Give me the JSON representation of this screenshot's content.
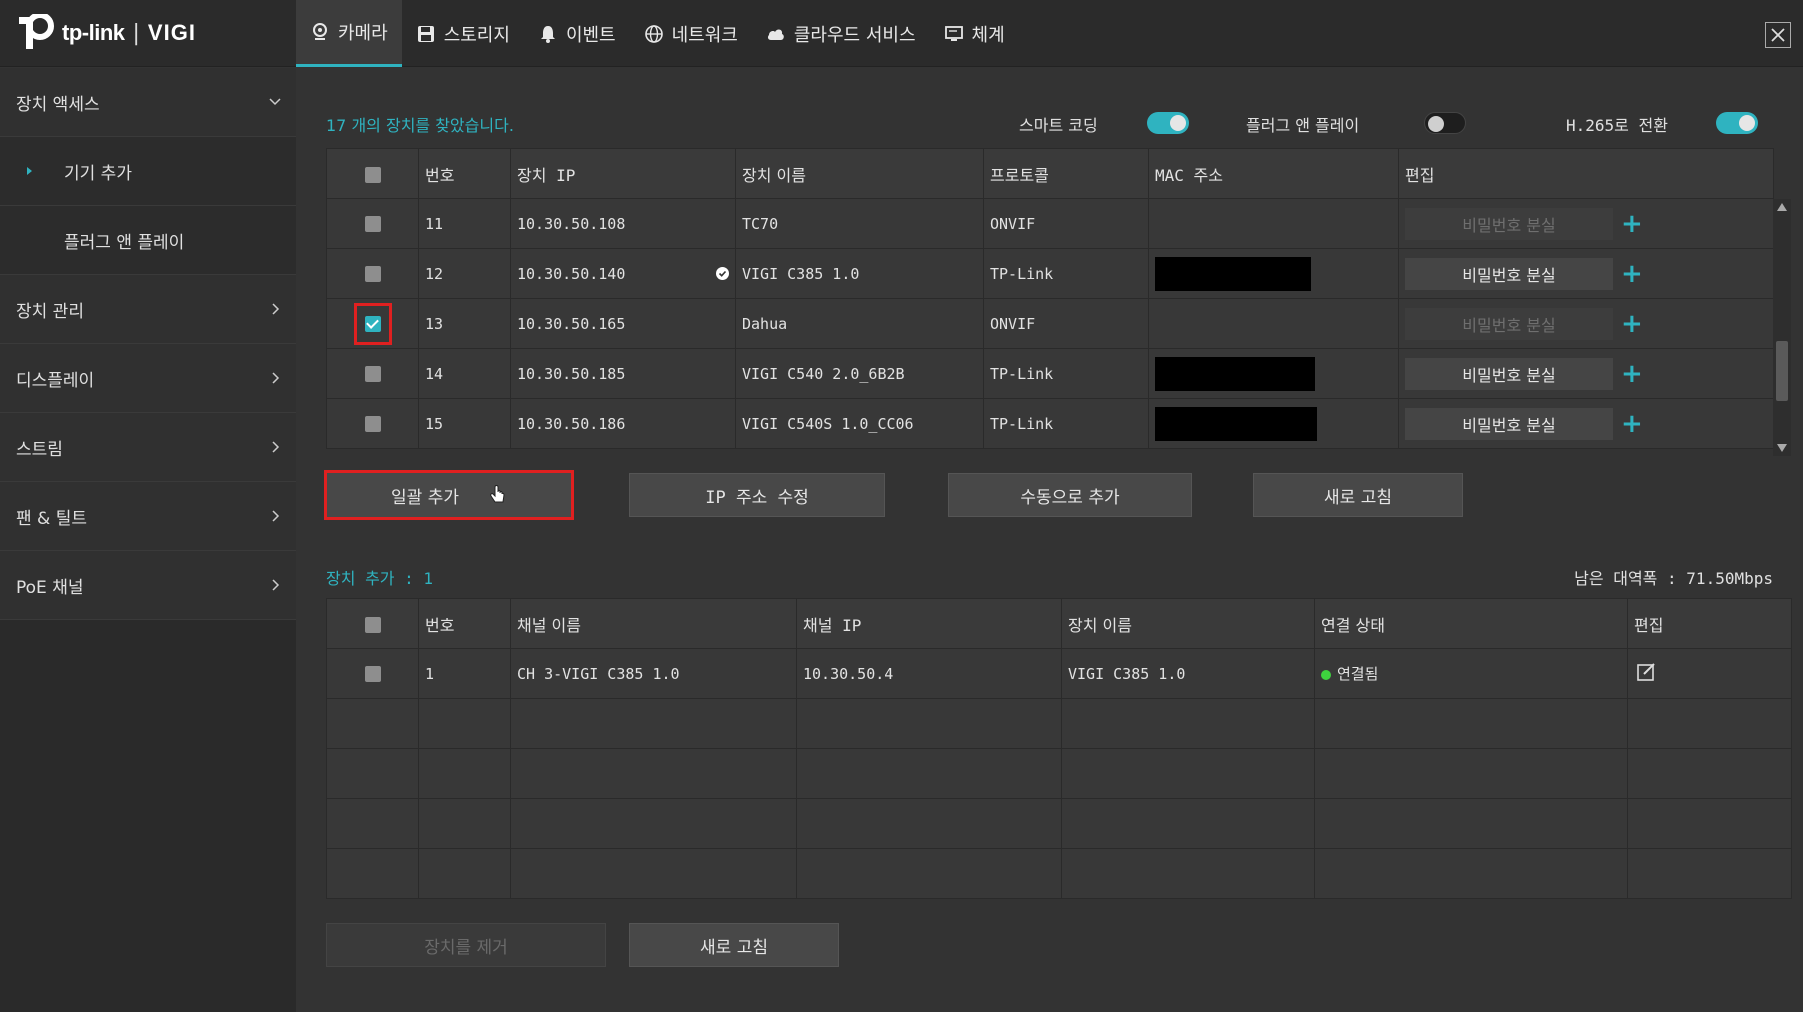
{
  "brand": {
    "logo_text": "tp-link",
    "logo_separator": "|",
    "product": "VIGI"
  },
  "tabs": [
    {
      "label": "카메라",
      "icon": "camera-icon",
      "active": true
    },
    {
      "label": "스토리지",
      "icon": "save-icon"
    },
    {
      "label": "이벤트",
      "icon": "bell-icon"
    },
    {
      "label": "네트워크",
      "icon": "globe-icon"
    },
    {
      "label": "클라우드 서비스",
      "icon": "cloud-icon"
    },
    {
      "label": "체계",
      "icon": "monitor-icon"
    }
  ],
  "sidebar": {
    "items": [
      {
        "label": "장치 액세스",
        "chevron": "down"
      },
      {
        "label": "기기 추가",
        "sub": true,
        "active": true
      },
      {
        "label": "플러그 앤 플레이",
        "sub": true
      },
      {
        "label": "장치 관리",
        "chevron": "right"
      },
      {
        "label": "디스플레이",
        "chevron": "right"
      },
      {
        "label": "스트림",
        "chevron": "right"
      },
      {
        "label": "팬 & 틸트",
        "chevron": "right"
      },
      {
        "label": "PoE 채널",
        "chevron": "right"
      }
    ]
  },
  "discovery": {
    "found_text": "17 개의 장치를 찾았습니다.",
    "smart_coding_label": "스마트 코딩",
    "smart_coding_on": true,
    "plug_play_label": "플러그 앤 플레이",
    "plug_play_on": false,
    "h265_label": "H.265로 전환",
    "h265_on": true,
    "headers": [
      "번호",
      "장치 IP",
      "장치 이름",
      "프로토콜",
      "MAC 주소",
      "편집"
    ],
    "rows": [
      {
        "no": "11",
        "ip": "10.30.50.108",
        "name": "TC70",
        "protocol": "ONVIF",
        "mac_redacted": false,
        "pw_enabled": false,
        "checked": false
      },
      {
        "no": "12",
        "ip": "10.30.50.140",
        "name": "VIGI C385 1.0",
        "protocol": "TP-Link",
        "mac_redacted": true,
        "pw_enabled": true,
        "checked": false,
        "verified": true
      },
      {
        "no": "13",
        "ip": "10.30.50.165",
        "name": "Dahua",
        "protocol": "ONVIF",
        "mac_redacted": false,
        "pw_enabled": false,
        "checked": true
      },
      {
        "no": "14",
        "ip": "10.30.50.185",
        "name": "VIGI C540 2.0_6B2B",
        "protocol": "TP-Link",
        "mac_redacted": true,
        "pw_enabled": true,
        "checked": false
      },
      {
        "no": "15",
        "ip": "10.30.50.186",
        "name": "VIGI C540S 1.0_CC06",
        "protocol": "TP-Link",
        "mac_redacted": true,
        "pw_enabled": true,
        "checked": false
      }
    ],
    "forgot_pw_label": "비밀번호 분실",
    "buttons": {
      "batch_add": "일괄 추가",
      "modify_ip": "IP 주소 수정",
      "manual_add": "수동으로 추가",
      "refresh": "새로 고침"
    }
  },
  "added": {
    "label": "장치 추가 : 1",
    "bandwidth": "남은 대역폭 : 71.50Mbps",
    "headers": [
      "번호",
      "채널 이름",
      "채널 IP",
      "장치 이름",
      "연결 상태",
      "편집"
    ],
    "rows": [
      {
        "no": "1",
        "channel_name": "CH 3-VIGI C385 1.0",
        "channel_ip": "10.30.50.4",
        "device_name": "VIGI C385 1.0",
        "status": "연결됨",
        "status_color": "#3ed23e"
      }
    ],
    "buttons": {
      "remove": "장치를 제거",
      "refresh": "새로 고침"
    }
  },
  "colors": {
    "accent": "#2fb3c0",
    "highlight": "#e02020"
  }
}
